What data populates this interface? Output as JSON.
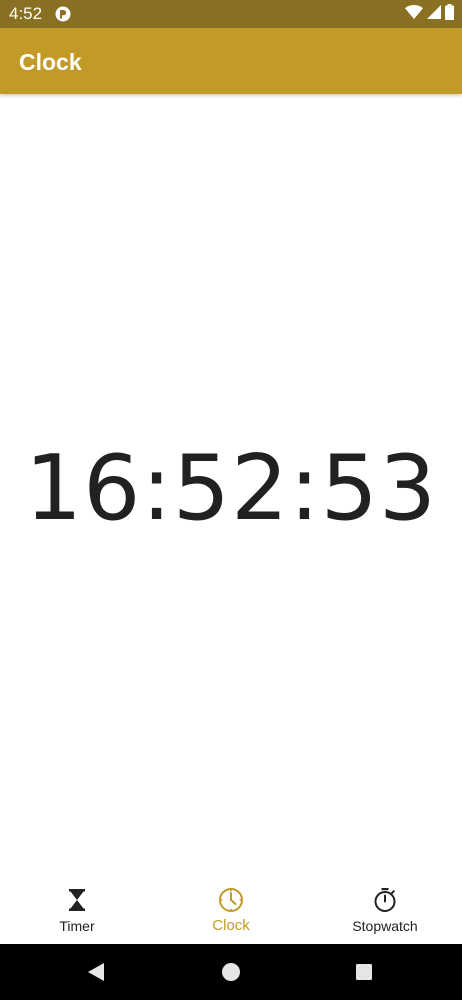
{
  "status_bar": {
    "time": "4:52",
    "icons": [
      "app-notification-icon",
      "wifi-icon",
      "signal-icon",
      "battery-icon"
    ]
  },
  "app_bar": {
    "title": "Clock"
  },
  "clock": {
    "time": "16:52:53"
  },
  "bottom_nav": {
    "items": [
      {
        "label": "Timer",
        "icon": "hourglass-icon",
        "active": false
      },
      {
        "label": "Clock",
        "icon": "clock-icon",
        "active": true
      },
      {
        "label": "Stopwatch",
        "icon": "stopwatch-icon",
        "active": false
      }
    ]
  },
  "system_nav": {
    "buttons": [
      "back-button",
      "home-button",
      "recents-button"
    ]
  },
  "colors": {
    "status_bar": "#8a7023",
    "app_bar": "#c19a27",
    "accent": "#c19a27",
    "text": "#212121",
    "system_nav": "#000000"
  }
}
